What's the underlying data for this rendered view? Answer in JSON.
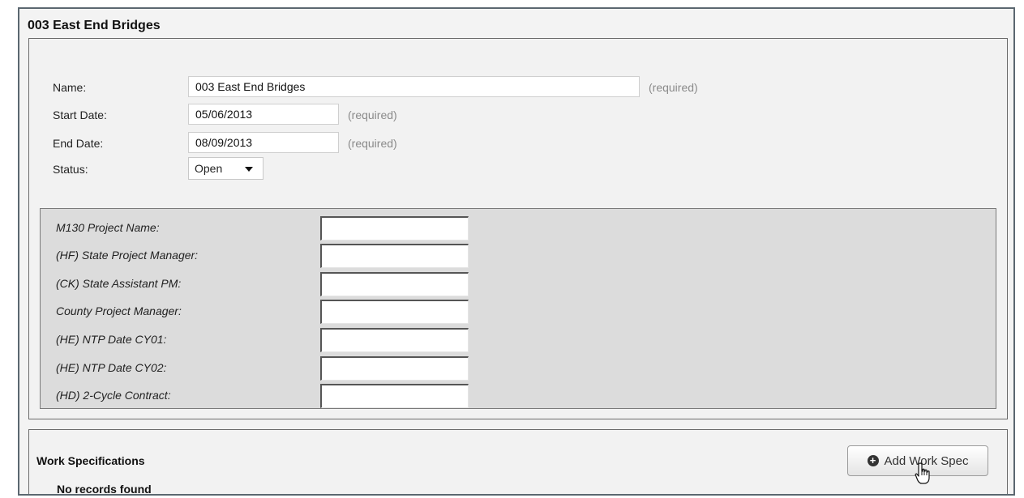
{
  "title": "003 East End Bridges",
  "form": {
    "name_label": "Name:",
    "name_value": "003 East End Bridges",
    "start_label": "Start Date:",
    "start_value": "05/06/2013",
    "end_label": "End Date:",
    "end_value": "08/09/2013",
    "status_label": "Status:",
    "status_value": "Open",
    "required": "(required)"
  },
  "custom_fields": [
    {
      "label": "M130 Project Name:",
      "value": ""
    },
    {
      "label": "(HF) State Project Manager:",
      "value": ""
    },
    {
      "label": "(CK) State Assistant PM:",
      "value": ""
    },
    {
      "label": "County Project Manager:",
      "value": ""
    },
    {
      "label": "(HE) NTP Date CY01:",
      "value": ""
    },
    {
      "label": "(HE) NTP Date CY02:",
      "value": ""
    },
    {
      "label": "(HD) 2-Cycle Contract:",
      "value": ""
    }
  ],
  "work_specs": {
    "title": "Work Specifications",
    "empty": "No records found",
    "add_label": "Add Work Spec"
  },
  "icons": {
    "add": "plus-circle-icon",
    "cursor": "hand-pointer-icon",
    "dropdown": "chevron-down-icon"
  }
}
